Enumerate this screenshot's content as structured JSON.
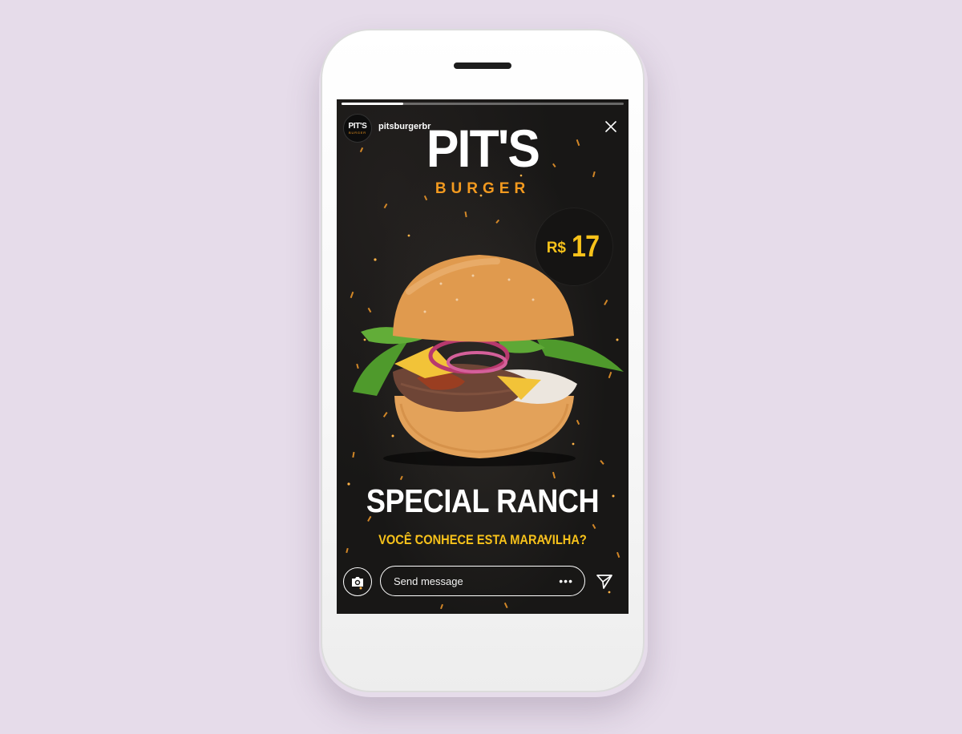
{
  "story": {
    "username": "pitsburgerbr",
    "avatar": {
      "main": "PIT'S",
      "sub": "BURGER"
    },
    "progress_fraction": 0.22,
    "close_icon": "close-icon"
  },
  "ad": {
    "brand_title": "PIT'S",
    "brand_subtitle": "BURGER",
    "price_currency": "R$",
    "price_value": "17",
    "product_name": "SPECIAL RANCH",
    "tagline": "VOCÊ CONHECE ESTA MARAVILHA?",
    "image": "burger-photo"
  },
  "composer": {
    "placeholder": "Send message",
    "camera_icon": "camera-icon",
    "more_icon": "more-icon",
    "send_icon": "send-icon"
  },
  "colors": {
    "background": "#e6dcea",
    "accent_orange": "#f39a1f",
    "accent_yellow": "#f7c21a",
    "screen_bg": "#151413"
  }
}
